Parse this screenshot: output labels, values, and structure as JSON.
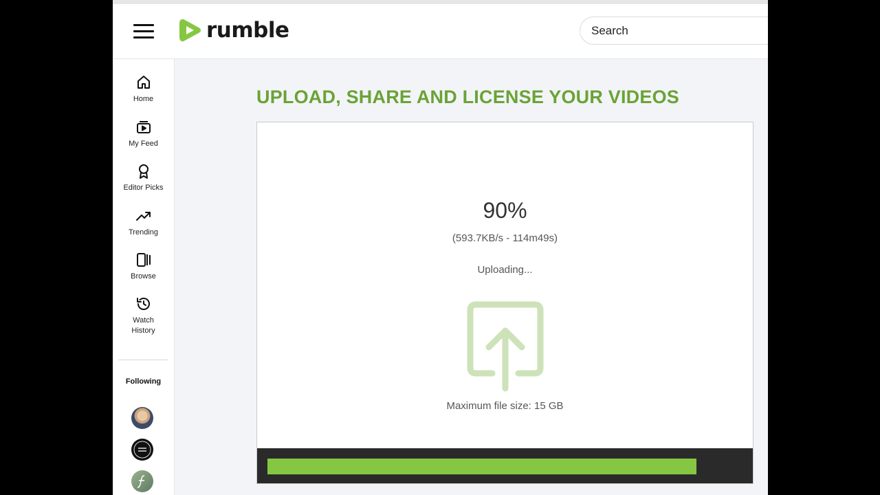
{
  "header": {
    "logo_text": "rumble",
    "search_placeholder": "Search",
    "brand_color": "#85c742"
  },
  "sidebar": {
    "items": [
      {
        "label": "Home",
        "icon": "home-icon"
      },
      {
        "label": "My Feed",
        "icon": "feed-icon"
      },
      {
        "label": "Editor Picks",
        "icon": "award-icon"
      },
      {
        "label": "Trending",
        "icon": "trending-icon"
      },
      {
        "label": "Browse",
        "icon": "browse-icon"
      },
      {
        "label": "Watch History",
        "icon": "history-icon"
      }
    ],
    "following_label": "Following"
  },
  "main": {
    "title": "UPLOAD, SHARE AND LICENSE YOUR VIDEOS",
    "upload": {
      "percent_text": "90%",
      "speed_text": "(593.7KB/s - 114m49s)",
      "status_text": "Uploading...",
      "max_file_text": "Maximum file size: 15 GB",
      "progress_fraction": 0.9
    }
  }
}
